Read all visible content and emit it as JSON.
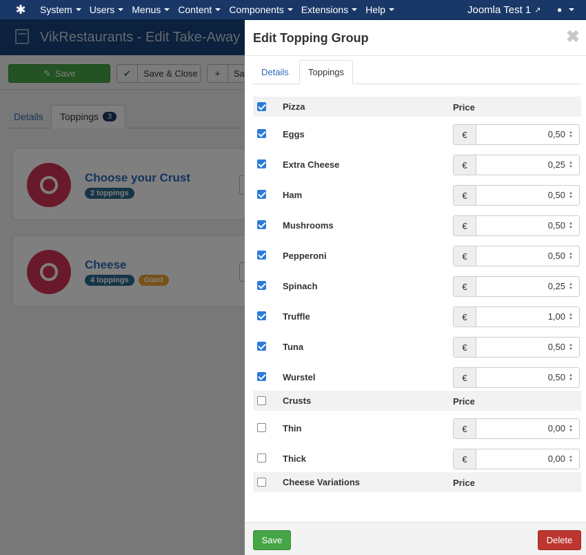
{
  "nav": {
    "logo_icon": "joomla-logo",
    "menu": [
      "System",
      "Users",
      "Menus",
      "Content",
      "Components",
      "Extensions",
      "Help"
    ],
    "site_name": "Joomla Test 1",
    "site_icon": "external-link-icon",
    "user_icon": "user-icon"
  },
  "header": {
    "title": "VikRestaurants - Edit Take-Away"
  },
  "toolbar": {
    "save_label": "Save",
    "save_close_label": "Save & Close",
    "save_new_label": "Sav"
  },
  "bg_tabs": {
    "details": "Details",
    "toppings": "Toppings",
    "toppings_count": "3"
  },
  "groups_bg": [
    {
      "title": "Choose your Crust",
      "badges": [
        "2 toppings"
      ]
    },
    {
      "title": "Cheese",
      "badges": [
        "4 toppings",
        "Giant"
      ]
    }
  ],
  "modal": {
    "title": "Edit Topping Group",
    "tabs": [
      "Details",
      "Toppings"
    ],
    "price_header": "Price",
    "currency": "€",
    "groups": [
      {
        "name": "Pizza",
        "checked": true,
        "items": [
          {
            "name": "Eggs",
            "price": "0,50",
            "checked": true
          },
          {
            "name": "Extra Cheese",
            "price": "0,25",
            "checked": true
          },
          {
            "name": "Ham",
            "price": "0,50",
            "checked": true
          },
          {
            "name": "Mushrooms",
            "price": "0,50",
            "checked": true
          },
          {
            "name": "Pepperoni",
            "price": "0,50",
            "checked": true
          },
          {
            "name": "Spinach",
            "price": "0,25",
            "checked": true
          },
          {
            "name": "Truffle",
            "price": "1,00",
            "checked": true
          },
          {
            "name": "Tuna",
            "price": "0,50",
            "checked": true
          },
          {
            "name": "Wurstel",
            "price": "0,50",
            "checked": true
          }
        ]
      },
      {
        "name": "Crusts",
        "checked": false,
        "items": [
          {
            "name": "Thin",
            "price": "0,00",
            "checked": false
          },
          {
            "name": "Thick",
            "price": "0,00",
            "checked": false
          }
        ]
      },
      {
        "name": "Cheese Variations",
        "checked": false,
        "items": []
      }
    ],
    "save_label": "Save",
    "delete_label": "Delete"
  }
}
